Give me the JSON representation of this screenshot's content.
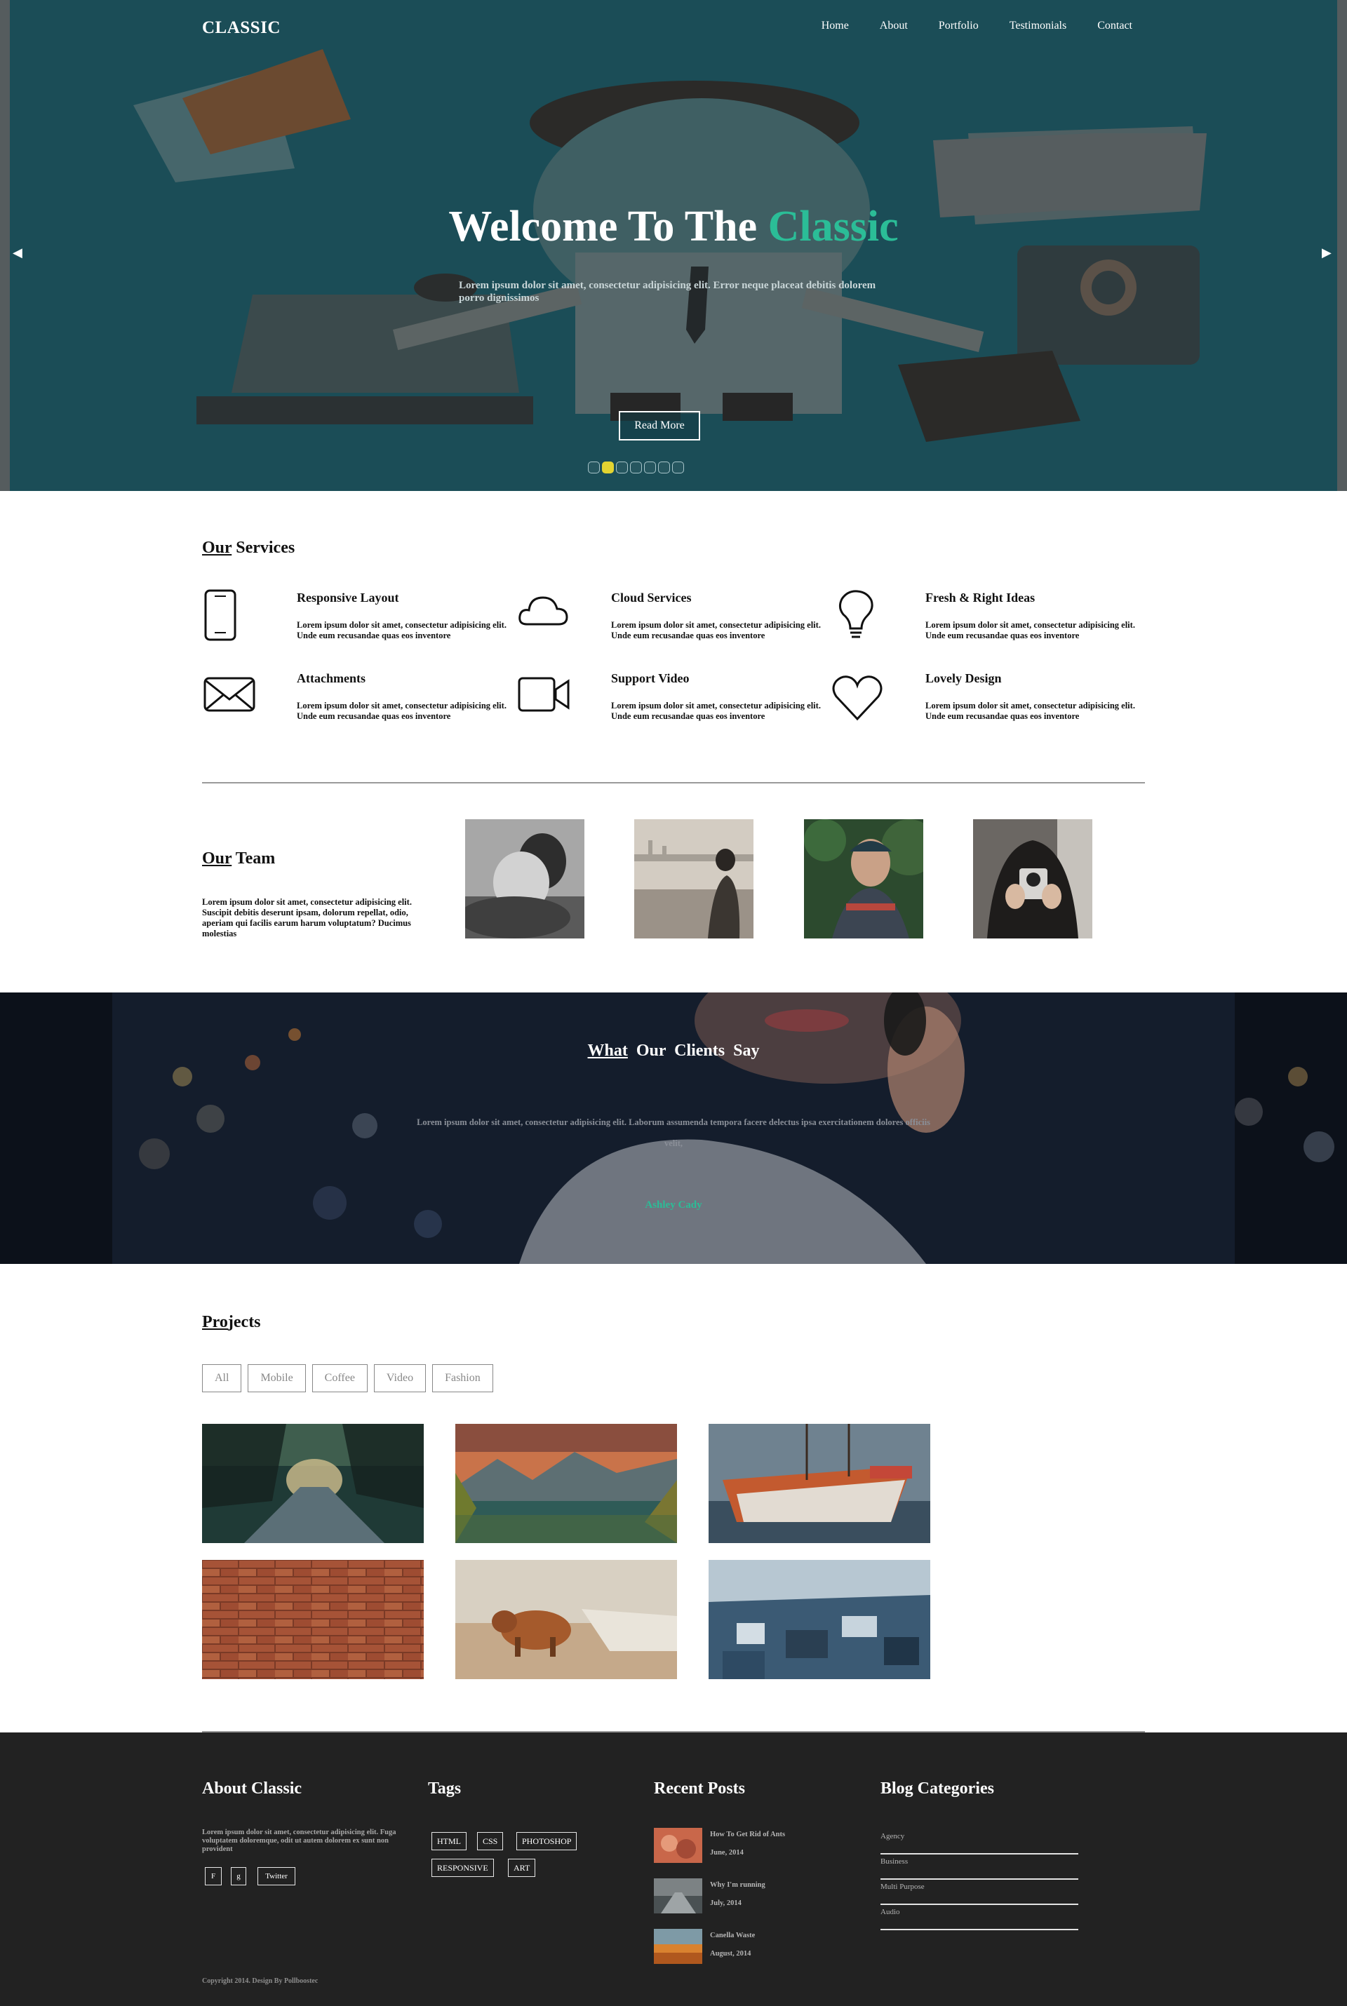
{
  "header": {
    "brand": "CLASSIC",
    "nav": [
      "Home",
      "About",
      "Portfolio",
      "Testimonials",
      "Contact"
    ]
  },
  "hero": {
    "title_main": "Welcome To The ",
    "title_accent": "Classic",
    "text": "Lorem ipsum dolor sit amet, consectetur adipisicing elit. Error neque placeat debitis dolorem porro dignissimos",
    "button": "Read More",
    "slide_count": 7,
    "active_slide": 2,
    "accent_color": "#2bbd97"
  },
  "services": {
    "title_a": "Our",
    "title_b": " Services",
    "items": [
      {
        "icon": "tablet-icon",
        "title": "Responsive Layout",
        "text": "Lorem ipsum dolor sit amet, consectetur adipisicing elit. Unde eum recusandae quas eos inventore"
      },
      {
        "icon": "cloud-icon",
        "title": "Cloud Services",
        "text": "Lorem ipsum dolor sit amet, consectetur adipisicing elit. Unde eum recusandae quas eos inventore"
      },
      {
        "icon": "lightbulb-icon",
        "title": "Fresh & Right Ideas",
        "text": "Lorem ipsum dolor sit amet, consectetur adipisicing elit. Unde eum recusandae quas eos inventore"
      },
      {
        "icon": "envelope-icon",
        "title": "Attachments",
        "text": "Lorem ipsum dolor sit amet, consectetur adipisicing elit. Unde eum recusandae quas eos inventore"
      },
      {
        "icon": "video-camera-icon",
        "title": "Support Video",
        "text": "Lorem ipsum dolor sit amet, consectetur adipisicing elit. Unde eum recusandae quas eos inventore"
      },
      {
        "icon": "heart-icon",
        "title": "Lovely Design",
        "text": "Lorem ipsum dolor sit amet, consectetur adipisicing elit. Unde eum recusandae quas eos inventore"
      }
    ]
  },
  "team": {
    "title_a": "Our",
    "title_b": " Team",
    "text": "Lorem ipsum dolor sit amet, consectetur adipisicing elit. Suscipit debitis deserunt ipsam, dolorum repellat, odio, aperiam qui facilis earum harum voluptatum? Ducimus molestias"
  },
  "testimonial": {
    "title_a": "What",
    "title_b": " Our Clients Say",
    "quote": "Lorem ipsum dolor sit amet, consectetur adipisicing elit. Laborum assumenda tempora facere delectus ipsa exercitationem dolores officiis velit,",
    "author": "Ashley Cady"
  },
  "projects": {
    "title_a": "Pro",
    "title_b": "jects",
    "filters": [
      "All",
      "Mobile",
      "Coffee",
      "Video",
      "Fashion"
    ]
  },
  "footer": {
    "about_title": "About Classic",
    "about_text": "Lorem ipsum dolor sit amet, consectetur adipisicing elit. Fuga voluptatem doloremque, odit ut autem dolorem ex sunt non provident",
    "social": [
      "F",
      "g",
      "Twitter"
    ],
    "tags_title": "Tags",
    "tags": [
      "HTML",
      "CSS",
      "PHOTOSHOP",
      "RESPONSIVE",
      "ART"
    ],
    "posts_title": "Recent Posts",
    "posts": [
      {
        "title": "How To Get Rid of Ants",
        "date": "June, 2014"
      },
      {
        "title": "Why I'm running",
        "date": "July, 2014"
      },
      {
        "title": "Canella Waste",
        "date": "August, 2014"
      }
    ],
    "categories_title": "Blog Categories",
    "categories": [
      "Agency",
      "Business",
      "Multi Purpose",
      "Audio"
    ],
    "copyright": "Copyright 2014. Design By Pollboostec"
  }
}
